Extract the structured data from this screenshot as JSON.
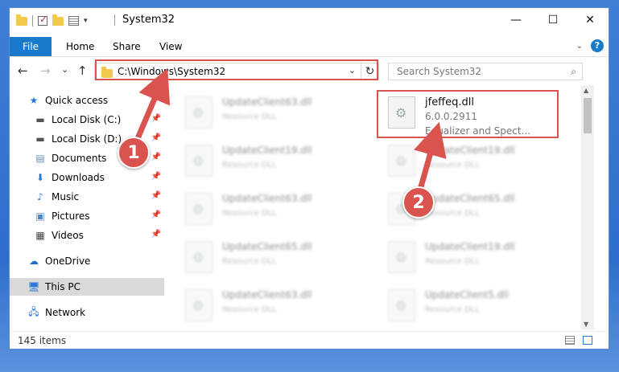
{
  "window": {
    "title": "System32",
    "minimize": "—",
    "maximize": "☐",
    "close": "✕"
  },
  "ribbon": {
    "tabs": [
      "File",
      "Home",
      "Share",
      "View"
    ],
    "help": "?"
  },
  "nav": {
    "back": "←",
    "forward": "→",
    "recent": "⌄",
    "up": "↑",
    "address": "C:\\Windows\\System32",
    "refresh": "↻",
    "search_placeholder": "Search System32"
  },
  "sidebar": {
    "items": [
      {
        "label": "Quick access",
        "icon": "star-icon"
      },
      {
        "label": "Local Disk (C:)",
        "icon": "drive-icon"
      },
      {
        "label": "Local Disk (D:)",
        "icon": "drive-icon"
      },
      {
        "label": "Documents",
        "icon": "documents-icon"
      },
      {
        "label": "Downloads",
        "icon": "download-icon"
      },
      {
        "label": "Music",
        "icon": "music-icon"
      },
      {
        "label": "Pictures",
        "icon": "pictures-icon"
      },
      {
        "label": "Videos",
        "icon": "videos-icon"
      },
      {
        "label": "OneDrive",
        "icon": "cloud-icon"
      },
      {
        "label": "This PC",
        "icon": "computer-icon"
      },
      {
        "label": "Network",
        "icon": "network-icon"
      }
    ]
  },
  "files": {
    "left": [
      {
        "name": "UpdateClient63.dll",
        "type": "Resource DLL"
      },
      {
        "name": "UpdateClient19.dll",
        "type": "Resource DLL"
      },
      {
        "name": "UpdateClient63.dll",
        "type": "Resource DLL"
      },
      {
        "name": "UpdateClient65.dll",
        "type": "Resource DLL"
      },
      {
        "name": "UpdateClient63.dll",
        "type": "Resource DLL"
      }
    ],
    "right": [
      {
        "name": "UpdateClient19.dll",
        "type": "Resource DLL"
      },
      {
        "name": "UpdateClient65.dll",
        "type": "Resource DLL"
      },
      {
        "name": "UpdateClient19.dll",
        "type": "Resource DLL"
      },
      {
        "name": "UpdateClient5.dll",
        "type": "Resource DLL"
      }
    ],
    "selected": {
      "name": "jfeffeq.dll",
      "version": "6.0.0.2911",
      "description": "Equalizer and Spect..."
    }
  },
  "status": {
    "item_count": "145 items"
  },
  "annotations": {
    "step1": "1",
    "step2": "2",
    "color": "#d9534f"
  }
}
